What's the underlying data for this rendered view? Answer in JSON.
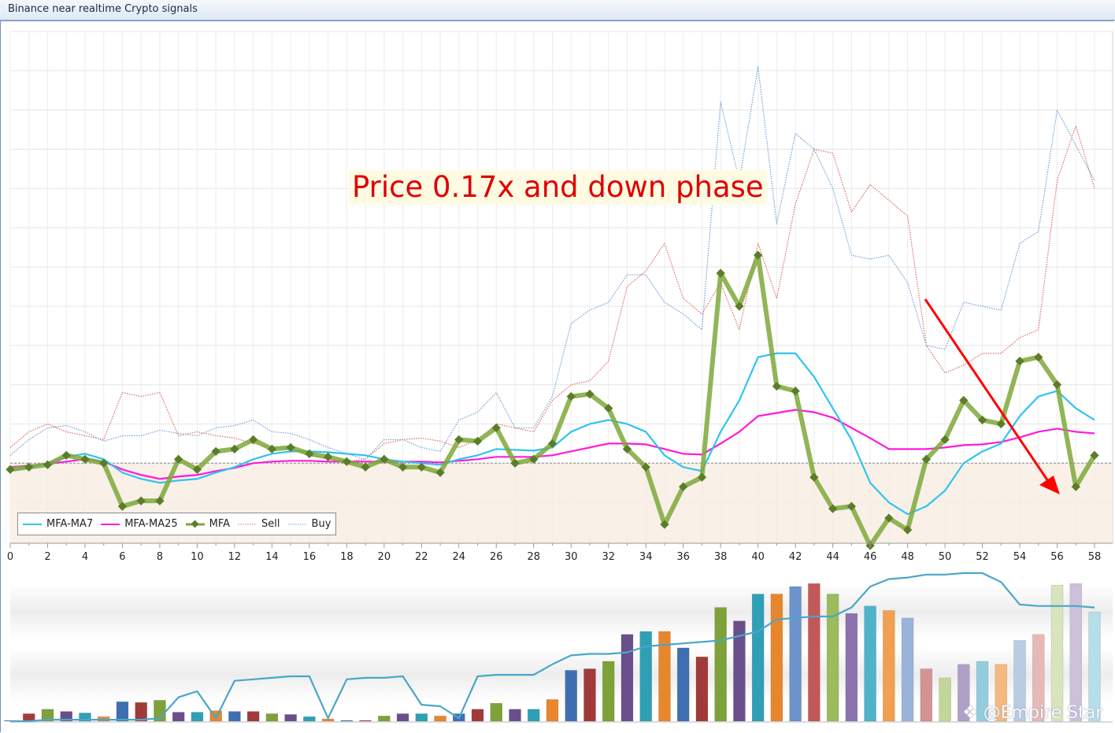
{
  "window": {
    "title": "Binance near realtime Crypto signals"
  },
  "annotation": {
    "text": "Price 0.17x and down phase"
  },
  "watermark": {
    "text": "@Empire Star"
  },
  "colors": {
    "ma7": "#2ec4f2",
    "ma25": "#ff1adc",
    "mfa": "#7ea83a",
    "mfa_marker": "#5b7d2a",
    "sell": "#e06a6a",
    "buy": "#6f9fd8",
    "arrow": "#ff0000",
    "baseline_fill": "#f8ece2",
    "volume_line": "#4aa6c8"
  },
  "chart_data": [
    {
      "type": "line",
      "xlabel": "",
      "ylabel": "",
      "xlim": [
        0,
        58
      ],
      "ylim": [
        -1.0,
        5.5
      ],
      "baseline": 0,
      "grid": true,
      "legend_position": "bottom-left",
      "x_ticks": [
        0,
        2,
        4,
        6,
        8,
        10,
        12,
        14,
        16,
        18,
        20,
        22,
        24,
        26,
        28,
        30,
        32,
        34,
        36,
        38,
        40,
        42,
        44,
        46,
        48,
        50,
        52,
        54,
        56,
        58
      ],
      "x": [
        0,
        1,
        2,
        3,
        4,
        5,
        6,
        7,
        8,
        9,
        10,
        11,
        12,
        13,
        14,
        15,
        16,
        17,
        18,
        19,
        20,
        21,
        22,
        23,
        24,
        25,
        26,
        27,
        28,
        29,
        30,
        31,
        32,
        33,
        34,
        35,
        36,
        37,
        38,
        39,
        40,
        41,
        42,
        43,
        44,
        45,
        46,
        47,
        48,
        49,
        50,
        51,
        52,
        53,
        54,
        55,
        56,
        57,
        58
      ],
      "series": [
        {
          "name": "MFA-MA7",
          "style": "solid",
          "values": [
            -0.1,
            -0.05,
            0.0,
            0.08,
            0.12,
            0.05,
            -0.12,
            -0.2,
            -0.25,
            -0.22,
            -0.2,
            -0.12,
            -0.05,
            0.05,
            0.12,
            0.15,
            0.15,
            0.14,
            0.12,
            0.1,
            0.05,
            0.02,
            0.0,
            -0.02,
            0.05,
            0.1,
            0.18,
            0.17,
            0.16,
            0.2,
            0.4,
            0.5,
            0.55,
            0.5,
            0.4,
            0.1,
            -0.05,
            -0.1,
            0.4,
            0.8,
            1.35,
            1.4,
            1.4,
            1.1,
            0.7,
            0.3,
            -0.25,
            -0.5,
            -0.65,
            -0.55,
            -0.35,
            0.0,
            0.15,
            0.25,
            0.6,
            0.85,
            0.92,
            0.7,
            0.55
          ]
        },
        {
          "name": "MFA-MA25",
          "style": "solid",
          "values": [
            -0.05,
            -0.03,
            -0.01,
            0.02,
            0.05,
            0.02,
            -0.08,
            -0.15,
            -0.2,
            -0.17,
            -0.15,
            -0.1,
            -0.06,
            0.0,
            0.02,
            0.03,
            0.03,
            0.02,
            0.02,
            0.02,
            0.02,
            0.02,
            0.02,
            0.01,
            0.03,
            0.05,
            0.08,
            0.08,
            0.08,
            0.1,
            0.15,
            0.2,
            0.25,
            0.25,
            0.24,
            0.18,
            0.12,
            0.11,
            0.25,
            0.4,
            0.6,
            0.64,
            0.68,
            0.65,
            0.58,
            0.45,
            0.32,
            0.18,
            0.18,
            0.18,
            0.2,
            0.23,
            0.24,
            0.27,
            0.33,
            0.4,
            0.44,
            0.4,
            0.38
          ]
        },
        {
          "name": "MFA",
          "style": "thick-marker",
          "values": [
            -0.08,
            -0.05,
            -0.02,
            0.1,
            0.05,
            0.0,
            -0.55,
            -0.48,
            -0.48,
            0.05,
            -0.08,
            0.15,
            0.18,
            0.3,
            0.18,
            0.2,
            0.12,
            0.08,
            0.02,
            -0.05,
            0.05,
            -0.05,
            -0.05,
            -0.12,
            0.3,
            0.28,
            0.45,
            0.0,
            0.05,
            0.25,
            0.85,
            0.88,
            0.7,
            0.18,
            -0.05,
            -0.78,
            -0.3,
            -0.18,
            2.42,
            2.0,
            2.65,
            0.98,
            0.92,
            -0.18,
            -0.58,
            -0.55,
            -1.05,
            -0.7,
            -0.85,
            0.05,
            0.3,
            0.8,
            0.55,
            0.5,
            1.3,
            1.35,
            1.0,
            -0.3,
            0.1
          ]
        },
        {
          "name": "Sell",
          "style": "dotted",
          "values": [
            0.2,
            0.4,
            0.5,
            0.4,
            0.35,
            0.3,
            0.9,
            0.85,
            0.9,
            0.35,
            0.4,
            0.35,
            0.32,
            0.25,
            0.2,
            0.18,
            0.1,
            0.05,
            0.02,
            0.05,
            0.25,
            0.3,
            0.32,
            0.28,
            0.2,
            0.3,
            0.5,
            0.45,
            0.4,
            0.8,
            1.0,
            1.05,
            1.3,
            2.25,
            2.45,
            2.8,
            2.1,
            1.9,
            2.3,
            1.7,
            2.8,
            2.1,
            3.3,
            4.0,
            3.95,
            3.2,
            3.55,
            3.35,
            3.15,
            1.5,
            1.15,
            1.25,
            1.4,
            1.4,
            1.6,
            1.7,
            3.6,
            4.3,
            3.5
          ]
        },
        {
          "name": "Buy",
          "style": "dotted",
          "values": [
            0.1,
            0.3,
            0.45,
            0.48,
            0.4,
            0.28,
            0.35,
            0.35,
            0.42,
            0.38,
            0.35,
            0.45,
            0.48,
            0.55,
            0.4,
            0.38,
            0.3,
            0.2,
            0.12,
            0.05,
            0.3,
            0.3,
            0.2,
            0.15,
            0.55,
            0.65,
            0.9,
            0.45,
            0.45,
            0.85,
            1.78,
            1.95,
            2.05,
            2.4,
            2.4,
            2.05,
            1.9,
            1.7,
            4.6,
            3.6,
            5.05,
            3.05,
            4.2,
            4.0,
            3.5,
            2.65,
            2.6,
            2.65,
            2.3,
            1.5,
            1.45,
            2.05,
            2.0,
            1.95,
            2.8,
            2.95,
            4.5,
            4.05,
            3.6
          ]
        }
      ]
    },
    {
      "type": "bar",
      "x": [
        0,
        1,
        2,
        3,
        4,
        5,
        6,
        7,
        8,
        9,
        10,
        11,
        12,
        13,
        14,
        15,
        16,
        17,
        18,
        19,
        20,
        21,
        22,
        23,
        24,
        25,
        26,
        27,
        28,
        29,
        30,
        31,
        32,
        33,
        34,
        35,
        36,
        37,
        38,
        39,
        40,
        41,
        42,
        43,
        44,
        45,
        46,
        47,
        48,
        49,
        50,
        51,
        52,
        53,
        54,
        55,
        56,
        57,
        58
      ],
      "ylim": [
        0,
        100
      ],
      "values": [
        0.5,
        5,
        8,
        6.5,
        5.5,
        3,
        13,
        12.5,
        14,
        6,
        6,
        7,
        6.5,
        6.5,
        5,
        4.5,
        3,
        1.5,
        0.5,
        0.5,
        3.5,
        5,
        5,
        3.5,
        5,
        8,
        12,
        8,
        8,
        14.5,
        34,
        35,
        40,
        58,
        60,
        60,
        49,
        43,
        76,
        67,
        85,
        85,
        90,
        92,
        85,
        72,
        77,
        74,
        69,
        35,
        29,
        38,
        40,
        38,
        54,
        58,
        91,
        92,
        73
      ],
      "colors": [
        "#4f7fbf",
        "#a33a3a",
        "#7fa13a",
        "#6b4f8c",
        "#2f9fb5",
        "#e8862e",
        "#3f6fb0",
        "#a33a3a",
        "#7fa13a",
        "#6b4f8c",
        "#2f9fb5",
        "#e8862e",
        "#3f6fb0",
        "#a33a3a",
        "#7fa13a",
        "#6b4f8c",
        "#2f9fb5",
        "#e8862e",
        "#3f6fb0",
        "#a33a3a",
        "#7fa13a",
        "#6b4f8c",
        "#2f9fb5",
        "#e8862e",
        "#3f6fb0",
        "#a33a3a",
        "#7fa13a",
        "#6b4f8c",
        "#2f9fb5",
        "#e8862e",
        "#3f6fb0",
        "#a33a3a",
        "#7fa13a",
        "#6b4f8c",
        "#2f9fb5",
        "#e8862e",
        "#3f6fb0",
        "#a33a3a",
        "#7fa13a",
        "#6b4f8c",
        "#2f9fb5",
        "#e8862e",
        "#6c93cc",
        "#c25858",
        "#9bbb5c",
        "#8c73ab",
        "#50b3c9",
        "#f0a050",
        "#9ab3da",
        "#d49393",
        "#c2d69b",
        "#b0a0c8",
        "#93cddd",
        "#f5b880",
        "#b8cce4",
        "#e6b8b7",
        "#d7e4bd",
        "#ccc0da",
        "#b7dee8"
      ],
      "line": [
        0,
        0,
        1,
        1,
        1,
        1,
        1,
        1,
        2,
        16,
        20,
        2,
        27,
        28,
        29,
        30,
        30,
        2,
        28,
        29,
        29,
        30,
        11,
        10,
        2,
        30,
        31,
        31,
        31,
        38,
        44,
        45,
        45,
        46,
        50,
        51,
        52,
        53,
        54,
        57,
        60,
        68,
        69,
        70,
        70,
        76,
        90,
        95,
        96,
        98,
        98,
        99,
        99,
        93,
        78,
        77,
        77,
        77,
        76
      ]
    }
  ]
}
